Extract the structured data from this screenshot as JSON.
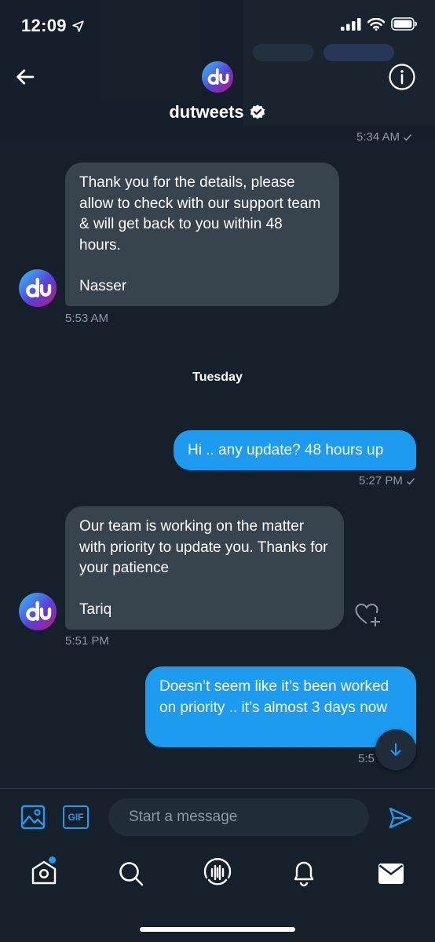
{
  "status_bar": {
    "time": "12:09"
  },
  "header": {
    "title": "dutweets"
  },
  "meta_top": {
    "time": "5:34 AM"
  },
  "messages": [
    {
      "text": "Thank you for the details, please allow to check with our support team & will get back to you within 48 hours.",
      "signature": "Nasser",
      "time": "5:53 AM"
    },
    {
      "text": "Hi .. any update? 48 hours up",
      "time": "5:27 PM"
    },
    {
      "text": "Our team is working on the matter with priority to update you. Thanks for your patience",
      "signature": "Tariq",
      "time": "5:51 PM"
    },
    {
      "text": "Doesn’t seem like it’s been worked on priority .. it’s almost 3 days now",
      "time": "5:5"
    }
  ],
  "day_separator": "Tuesday",
  "composer": {
    "placeholder": "Start a message",
    "gif_label": "GIF"
  },
  "colors": {
    "background": "#15202b",
    "incoming_bubble": "#38444d",
    "outgoing_bubble": "#1d9bf0",
    "accent": "#1d9bf0"
  },
  "nav": {
    "items": [
      {
        "icon": "home-icon",
        "has_badge": true
      },
      {
        "icon": "search-icon"
      },
      {
        "icon": "spaces-icon"
      },
      {
        "icon": "notifications-icon"
      },
      {
        "icon": "messages-icon",
        "active": true
      }
    ]
  }
}
